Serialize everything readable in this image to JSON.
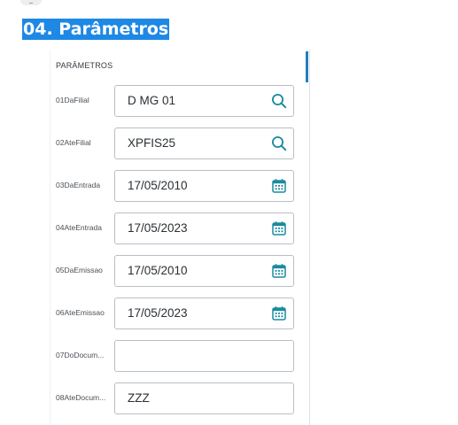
{
  "page": {
    "title": "04. Parâmetros"
  },
  "panel": {
    "section_title": "PARÂMETROS",
    "params": [
      {
        "label": "01DaFilial",
        "value": "D MG 01",
        "icon": "search-icon"
      },
      {
        "label": "02AteFilial",
        "value": "XPFIS25",
        "icon": "search-icon"
      },
      {
        "label": "03DaEntrada",
        "value": "17/05/2010",
        "icon": "calendar-icon"
      },
      {
        "label": "04AteEntrada",
        "value": "17/05/2023",
        "icon": "calendar-icon"
      },
      {
        "label": "05DaEmissao",
        "value": "17/05/2010",
        "icon": "calendar-icon"
      },
      {
        "label": "06AteEmissao",
        "value": "17/05/2023",
        "icon": "calendar-icon"
      },
      {
        "label": "07DoDocum...",
        "value": "",
        "icon": ""
      },
      {
        "label": "08AteDocum...",
        "value": "ZZZ",
        "icon": ""
      }
    ]
  },
  "colors": {
    "title_highlight": "#1e88e5",
    "icon_teal": "#1b8a9f",
    "scroll_thumb": "#1f7fbf",
    "field_border": "#b9bfc4"
  }
}
